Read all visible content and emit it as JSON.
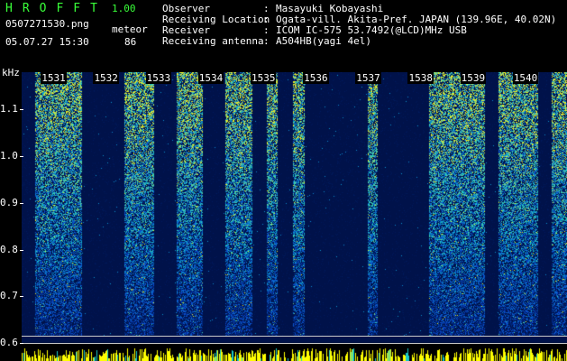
{
  "app": {
    "title": "HROFFT",
    "version": "1.00"
  },
  "file": {
    "name": "0507271530.png",
    "datetime": "05.07.27 15:30"
  },
  "count": {
    "type": "meteor",
    "value": "86"
  },
  "meta": [
    {
      "key": "Observer",
      "value": "Masayuki Kobayashi"
    },
    {
      "key": "Receiving Location",
      "value": "Ogata-vill. Akita-Pref. JAPAN (139.96E, 40.02N)"
    },
    {
      "key": "Receiver",
      "value": "ICOM IC-575 53.7492(@LCD)MHz USB"
    },
    {
      "key": "Receiving antenna",
      "value": "A504HB(yagi 4el)"
    }
  ],
  "meta_sep": ":",
  "colors": {
    "accent": "#39ff39",
    "background": "#000000",
    "plot_bg": "#00124a",
    "signal_low": "#0a3cc8",
    "signal_mid": "#19c8c8",
    "signal_high": "#ffeb00",
    "strip": "#ffff00"
  },
  "chart_data": {
    "type": "heatmap",
    "ylabel": "kHz",
    "yticks": [
      "1.1",
      "1.0",
      "0.9",
      "0.8",
      "0.7",
      "0.6"
    ],
    "y_values": [
      1.1,
      1.0,
      0.9,
      0.8,
      0.7,
      0.6
    ],
    "ylim": [
      0.6,
      1.18
    ],
    "xticks": [
      "1531",
      "1532",
      "1533",
      "1534",
      "1535",
      "1536",
      "1537",
      "1538",
      "1539",
      "1540"
    ],
    "x_values": [
      1531,
      1532,
      1533,
      1534,
      1535,
      1536,
      1537,
      1538,
      1539,
      1540
    ],
    "xlim": [
      1530.6,
      1541
    ],
    "legend": "none"
  }
}
